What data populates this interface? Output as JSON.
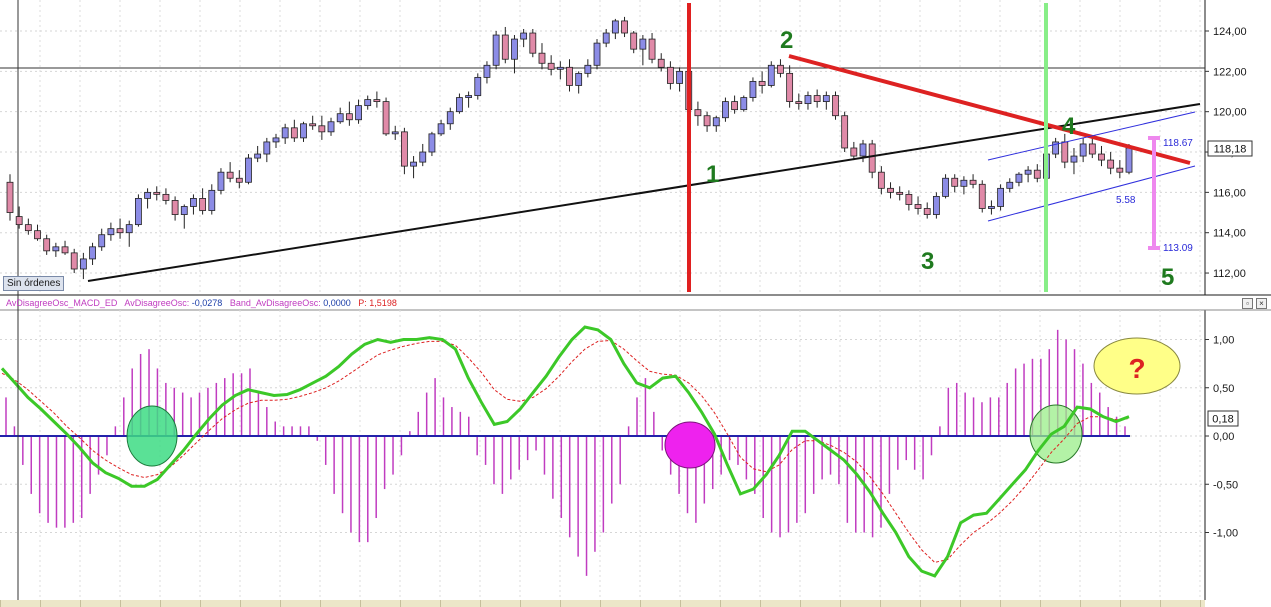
{
  "chart_data": [
    {
      "type": "candlestick",
      "title": "",
      "ylim": [
        111,
        125.5
      ],
      "yticks": [
        "124,00",
        "122,00",
        "120,00",
        "118,00",
        "116,00",
        "114,00",
        "112,00"
      ],
      "last_price": "118,18",
      "ohlc": [
        [
          116.5,
          116.9,
          114.6,
          115.0
        ],
        [
          114.8,
          115.3,
          114.2,
          114.4
        ],
        [
          114.4,
          114.7,
          113.9,
          114.1
        ],
        [
          114.1,
          114.4,
          113.6,
          113.7
        ],
        [
          113.7,
          113.9,
          112.9,
          113.1
        ],
        [
          113.1,
          113.5,
          112.8,
          113.3
        ],
        [
          113.3,
          113.6,
          112.9,
          113.0
        ],
        [
          113.0,
          113.2,
          112.0,
          112.2
        ],
        [
          112.2,
          113.0,
          111.7,
          112.7
        ],
        [
          112.7,
          113.5,
          112.4,
          113.3
        ],
        [
          113.3,
          114.2,
          113.1,
          113.9
        ],
        [
          113.9,
          114.5,
          113.6,
          114.2
        ],
        [
          114.2,
          114.7,
          113.7,
          114.0
        ],
        [
          114.0,
          114.6,
          113.3,
          114.4
        ],
        [
          114.4,
          115.9,
          114.3,
          115.7
        ],
        [
          115.7,
          116.2,
          115.2,
          116.0
        ],
        [
          116.0,
          116.3,
          115.6,
          115.9
        ],
        [
          115.9,
          116.2,
          115.4,
          115.6
        ],
        [
          115.6,
          115.8,
          114.6,
          114.9
        ],
        [
          114.9,
          115.4,
          114.2,
          115.3
        ],
        [
          115.3,
          115.9,
          114.9,
          115.7
        ],
        [
          115.7,
          116.2,
          114.9,
          115.1
        ],
        [
          115.1,
          116.4,
          114.9,
          116.1
        ],
        [
          116.1,
          117.2,
          115.9,
          117.0
        ],
        [
          117.0,
          117.5,
          116.5,
          116.7
        ],
        [
          116.7,
          117.1,
          116.2,
          116.5
        ],
        [
          116.5,
          117.9,
          116.4,
          117.7
        ],
        [
          117.7,
          118.3,
          117.5,
          117.9
        ],
        [
          117.9,
          118.7,
          117.5,
          118.5
        ],
        [
          118.5,
          118.9,
          118.2,
          118.7
        ],
        [
          118.7,
          119.4,
          118.4,
          119.2
        ],
        [
          119.2,
          119.6,
          118.5,
          118.7
        ],
        [
          118.7,
          119.5,
          118.5,
          119.4
        ],
        [
          119.4,
          119.8,
          119.1,
          119.3
        ],
        [
          119.3,
          119.8,
          118.6,
          119.0
        ],
        [
          119.0,
          119.7,
          118.8,
          119.5
        ],
        [
          119.5,
          120.2,
          119.4,
          119.9
        ],
        [
          119.9,
          120.5,
          119.3,
          119.6
        ],
        [
          119.6,
          120.6,
          119.4,
          120.3
        ],
        [
          120.3,
          120.8,
          120.1,
          120.6
        ],
        [
          120.6,
          121.0,
          120.2,
          120.5
        ],
        [
          120.5,
          120.7,
          118.8,
          118.9
        ],
        [
          118.9,
          119.3,
          118.6,
          119.0
        ],
        [
          119.0,
          119.2,
          116.9,
          117.3
        ],
        [
          117.3,
          117.8,
          116.7,
          117.5
        ],
        [
          117.5,
          118.4,
          117.3,
          118.0
        ],
        [
          118.0,
          119.0,
          117.8,
          118.9
        ],
        [
          118.9,
          119.6,
          118.8,
          119.4
        ],
        [
          119.4,
          120.2,
          119.1,
          120.0
        ],
        [
          120.0,
          120.9,
          119.9,
          120.7
        ],
        [
          120.7,
          121.0,
          120.2,
          120.8
        ],
        [
          120.8,
          121.9,
          120.6,
          121.7
        ],
        [
          121.7,
          122.5,
          121.4,
          122.3
        ],
        [
          122.3,
          124.0,
          122.1,
          123.8
        ],
        [
          123.8,
          124.2,
          122.4,
          122.6
        ],
        [
          122.6,
          123.8,
          121.9,
          123.6
        ],
        [
          123.6,
          124.1,
          123.2,
          123.9
        ],
        [
          123.9,
          124.1,
          122.7,
          122.9
        ],
        [
          122.9,
          123.4,
          122.1,
          122.4
        ],
        [
          122.4,
          122.8,
          121.8,
          122.1
        ],
        [
          122.1,
          122.5,
          121.6,
          122.2
        ],
        [
          122.2,
          122.6,
          121.0,
          121.3
        ],
        [
          121.3,
          122.0,
          120.9,
          121.9
        ],
        [
          121.9,
          122.6,
          121.7,
          122.3
        ],
        [
          122.3,
          123.6,
          122.1,
          123.4
        ],
        [
          123.4,
          124.1,
          123.2,
          123.9
        ],
        [
          123.9,
          124.6,
          123.6,
          124.5
        ],
        [
          124.5,
          124.7,
          123.7,
          123.9
        ],
        [
          123.9,
          124.0,
          122.9,
          123.1
        ],
        [
          123.1,
          123.8,
          122.3,
          123.6
        ],
        [
          123.6,
          123.9,
          122.4,
          122.6
        ],
        [
          122.6,
          122.9,
          122.0,
          122.2
        ],
        [
          122.2,
          122.5,
          121.1,
          121.4
        ],
        [
          121.4,
          122.2,
          121.0,
          122.0
        ],
        [
          122.0,
          122.3,
          119.7,
          120.1
        ],
        [
          120.1,
          120.5,
          119.3,
          119.8
        ],
        [
          119.8,
          120.0,
          119.0,
          119.3
        ],
        [
          119.3,
          119.8,
          119.0,
          119.7
        ],
        [
          119.7,
          120.7,
          119.5,
          120.5
        ],
        [
          120.5,
          120.8,
          119.9,
          120.1
        ],
        [
          120.1,
          120.8,
          120.0,
          120.7
        ],
        [
          120.7,
          121.7,
          120.5,
          121.5
        ],
        [
          121.5,
          122.0,
          120.9,
          121.3
        ],
        [
          121.3,
          122.5,
          121.2,
          122.3
        ],
        [
          122.3,
          122.6,
          121.7,
          121.9
        ],
        [
          121.9,
          122.3,
          120.2,
          120.5
        ],
        [
          120.5,
          120.9,
          120.1,
          120.4
        ],
        [
          120.4,
          121.0,
          120.1,
          120.8
        ],
        [
          120.8,
          121.1,
          120.2,
          120.5
        ],
        [
          120.5,
          121.0,
          120.1,
          120.8
        ],
        [
          120.8,
          121.0,
          119.6,
          119.8
        ],
        [
          119.8,
          120.0,
          118.0,
          118.2
        ],
        [
          118.2,
          118.5,
          117.6,
          117.8
        ],
        [
          117.8,
          118.6,
          117.5,
          118.4
        ],
        [
          118.4,
          118.6,
          116.7,
          117.0
        ],
        [
          117.0,
          117.3,
          115.9,
          116.2
        ],
        [
          116.2,
          116.5,
          115.7,
          116.0
        ],
        [
          116.0,
          116.3,
          115.6,
          115.9
        ],
        [
          115.9,
          116.1,
          115.1,
          115.4
        ],
        [
          115.4,
          115.8,
          114.9,
          115.2
        ],
        [
          115.2,
          115.5,
          114.7,
          114.9
        ],
        [
          114.9,
          116.0,
          114.7,
          115.8
        ],
        [
          115.8,
          116.9,
          115.7,
          116.7
        ],
        [
          116.7,
          116.9,
          116.0,
          116.3
        ],
        [
          116.3,
          116.8,
          115.9,
          116.6
        ],
        [
          116.6,
          116.9,
          116.2,
          116.4
        ],
        [
          116.4,
          116.6,
          115.0,
          115.2
        ],
        [
          115.2,
          115.6,
          114.9,
          115.3
        ],
        [
          115.3,
          116.4,
          115.1,
          116.2
        ],
        [
          116.2,
          116.7,
          116.0,
          116.5
        ],
        [
          116.5,
          117.0,
          116.3,
          116.9
        ],
        [
          116.9,
          117.3,
          116.5,
          117.1
        ],
        [
          117.1,
          117.4,
          116.5,
          116.7
        ],
        [
          116.7,
          118.1,
          116.6,
          117.9
        ],
        [
          117.9,
          118.7,
          117.7,
          118.5
        ],
        [
          118.5,
          118.9,
          117.2,
          117.5
        ],
        [
          117.5,
          118.2,
          116.9,
          117.8
        ],
        [
          117.8,
          118.7,
          117.5,
          118.4
        ],
        [
          118.4,
          118.8,
          117.7,
          117.9
        ],
        [
          117.9,
          118.3,
          117.3,
          117.6
        ],
        [
          117.6,
          118.0,
          116.9,
          117.2
        ],
        [
          117.2,
          117.6,
          116.7,
          117.0
        ],
        [
          117.0,
          118.4,
          116.9,
          118.2
        ]
      ]
    },
    {
      "type": "oscillator",
      "title": "",
      "ylim": [
        -1.45,
        1.25
      ],
      "yticks": [
        "1,00",
        "0,50",
        "0,00",
        "-0,50",
        "-1,00"
      ],
      "last_value": "0,18",
      "series": [
        {
          "name": "AvDisagreeOsc",
          "color": "#3cc828",
          "values": [
            0.7,
            0.55,
            0.4,
            0.28,
            0.15,
            0.02,
            -0.12,
            -0.28,
            -0.38,
            -0.44,
            -0.52,
            -0.52,
            -0.45,
            -0.3,
            -0.15,
            0.02,
            0.18,
            0.32,
            0.42,
            0.48,
            0.45,
            0.42,
            0.43,
            0.48,
            0.55,
            0.62,
            0.72,
            0.85,
            0.95,
            1.0,
            0.97,
            1.0,
            1.0,
            1.02,
            1.0,
            0.9,
            0.6,
            0.35,
            0.12,
            0.15,
            0.28,
            0.45,
            0.62,
            0.82,
            1.0,
            1.13,
            1.1,
            1.0,
            0.75,
            0.55,
            0.5,
            0.6,
            0.62,
            0.45,
            0.25,
            0.02,
            -0.3,
            -0.6,
            -0.55,
            -0.4,
            -0.2,
            0.05,
            0.05,
            -0.05,
            -0.15,
            -0.25,
            -0.4,
            -0.58,
            -0.8,
            -1.0,
            -1.25,
            -1.4,
            -1.45,
            -1.25,
            -0.9,
            -0.82,
            -0.8,
            -0.65,
            -0.5,
            -0.35,
            -0.15,
            0.02,
            0.1,
            0.3,
            0.28,
            0.2,
            0.15,
            0.2
          ]
        },
        {
          "name": "Band_AvDisagreeOsc",
          "color": "#dd2222",
          "values": [
            0.65,
            0.58,
            0.48,
            0.36,
            0.24,
            0.1,
            -0.02,
            -0.15,
            -0.25,
            -0.33,
            -0.4,
            -0.43,
            -0.4,
            -0.32,
            -0.2,
            -0.07,
            0.06,
            0.18,
            0.27,
            0.34,
            0.37,
            0.37,
            0.38,
            0.41,
            0.45,
            0.5,
            0.57,
            0.66,
            0.75,
            0.84,
            0.89,
            0.93,
            0.96,
            0.98,
            0.98,
            0.94,
            0.81,
            0.66,
            0.48,
            0.38,
            0.36,
            0.4,
            0.49,
            0.62,
            0.77,
            0.9,
            0.98,
            0.99,
            0.9,
            0.78,
            0.67,
            0.64,
            0.63,
            0.55,
            0.42,
            0.24,
            0.02,
            -0.22,
            -0.34,
            -0.37,
            -0.3,
            -0.14,
            -0.05,
            -0.05,
            -0.1,
            -0.17,
            -0.27,
            -0.42,
            -0.6,
            -0.8,
            -1.0,
            -1.18,
            -1.31,
            -1.28,
            -1.13,
            -1.0,
            -0.91,
            -0.8,
            -0.67,
            -0.52,
            -0.35,
            -0.17,
            -0.03,
            0.13,
            0.2,
            0.2,
            0.17,
            0.18
          ]
        },
        {
          "name": "Histogram",
          "color": "#c03cc0",
          "values": [
            0.4,
            0.1,
            -0.3,
            -0.6,
            -0.8,
            -0.9,
            -0.95,
            -0.95,
            -0.9,
            -0.85,
            -0.6,
            -0.4,
            -0.2,
            0.1,
            0.4,
            0.7,
            0.85,
            0.9,
            0.7,
            0.55,
            0.5,
            0.45,
            0.4,
            0.45,
            0.5,
            0.55,
            0.6,
            0.65,
            0.65,
            0.7,
            0.45,
            0.3,
            0.15,
            0.1,
            0.1,
            0.1,
            0.1,
            -0.05,
            -0.3,
            -0.6,
            -0.8,
            -1.0,
            -1.1,
            -1.1,
            -0.85,
            -0.55,
            -0.4,
            -0.2,
            0.05,
            0.25,
            0.45,
            0.6,
            0.4,
            0.3,
            0.25,
            0.2,
            -0.2,
            -0.3,
            -0.5,
            -0.6,
            -0.45,
            -0.35,
            -0.25,
            -0.15,
            -0.4,
            -0.65,
            -0.85,
            -1.05,
            -1.25,
            -1.45,
            -1.2,
            -1.0,
            -0.7,
            -0.5,
            0.1,
            0.4,
            0.6,
            0.25,
            -0.15,
            -0.4,
            -0.6,
            -0.8,
            -0.9,
            -0.7,
            -0.55,
            -0.4,
            -0.25,
            -0.3,
            -0.45,
            -0.6,
            -0.85,
            -1.0,
            -1.05,
            -1.0,
            -0.9,
            -0.8,
            -0.6,
            -0.45,
            -0.4,
            -0.5,
            -0.9,
            -1.0,
            -1.0,
            -1.05,
            -0.95,
            -0.6,
            -0.35,
            -0.25,
            -0.35,
            -0.45,
            -0.2,
            0.1,
            0.5,
            0.55,
            0.45,
            0.4,
            0.35,
            0.4,
            0.4,
            0.55,
            0.7,
            0.75,
            0.8,
            0.8,
            0.9,
            1.1,
            1.0,
            0.9,
            0.75,
            0.55,
            0.45,
            0.3,
            0.2,
            0.1
          ]
        }
      ]
    }
  ],
  "labels": {
    "sin_ordenes": "Sin órdenes",
    "wave_1": "1",
    "wave_2": "2",
    "wave_3": "3",
    "wave_4": "4",
    "wave_5": "5",
    "range_high": "118.67",
    "range_low": "113.09",
    "range_size": "5.58",
    "question": "?"
  },
  "osc_header": {
    "name": "AvDisagreeOsc_MACD_ED",
    "s1_label": "AvDisagreeOsc:",
    "s1_value": "-0,0278",
    "s2_label": "Band_AvDisagreeOsc:",
    "s2_value": "0,0000",
    "s3_label": "P:",
    "s3_value": "1,5198"
  },
  "colors": {
    "bull_candle": "#8c8ce6",
    "bear_candle": "#e08aa8",
    "trendline_black": "#111111",
    "trendline_red": "#dd2222",
    "channel_blue": "#3030dd",
    "vline_red": "#e02020",
    "vline_green": "#88ee88",
    "range_arrow": "#ee88ee",
    "macd_line": "#3cc828",
    "signal_line": "#dd2222",
    "histogram": "#c03cc0",
    "zero_line": "#2222aa"
  }
}
